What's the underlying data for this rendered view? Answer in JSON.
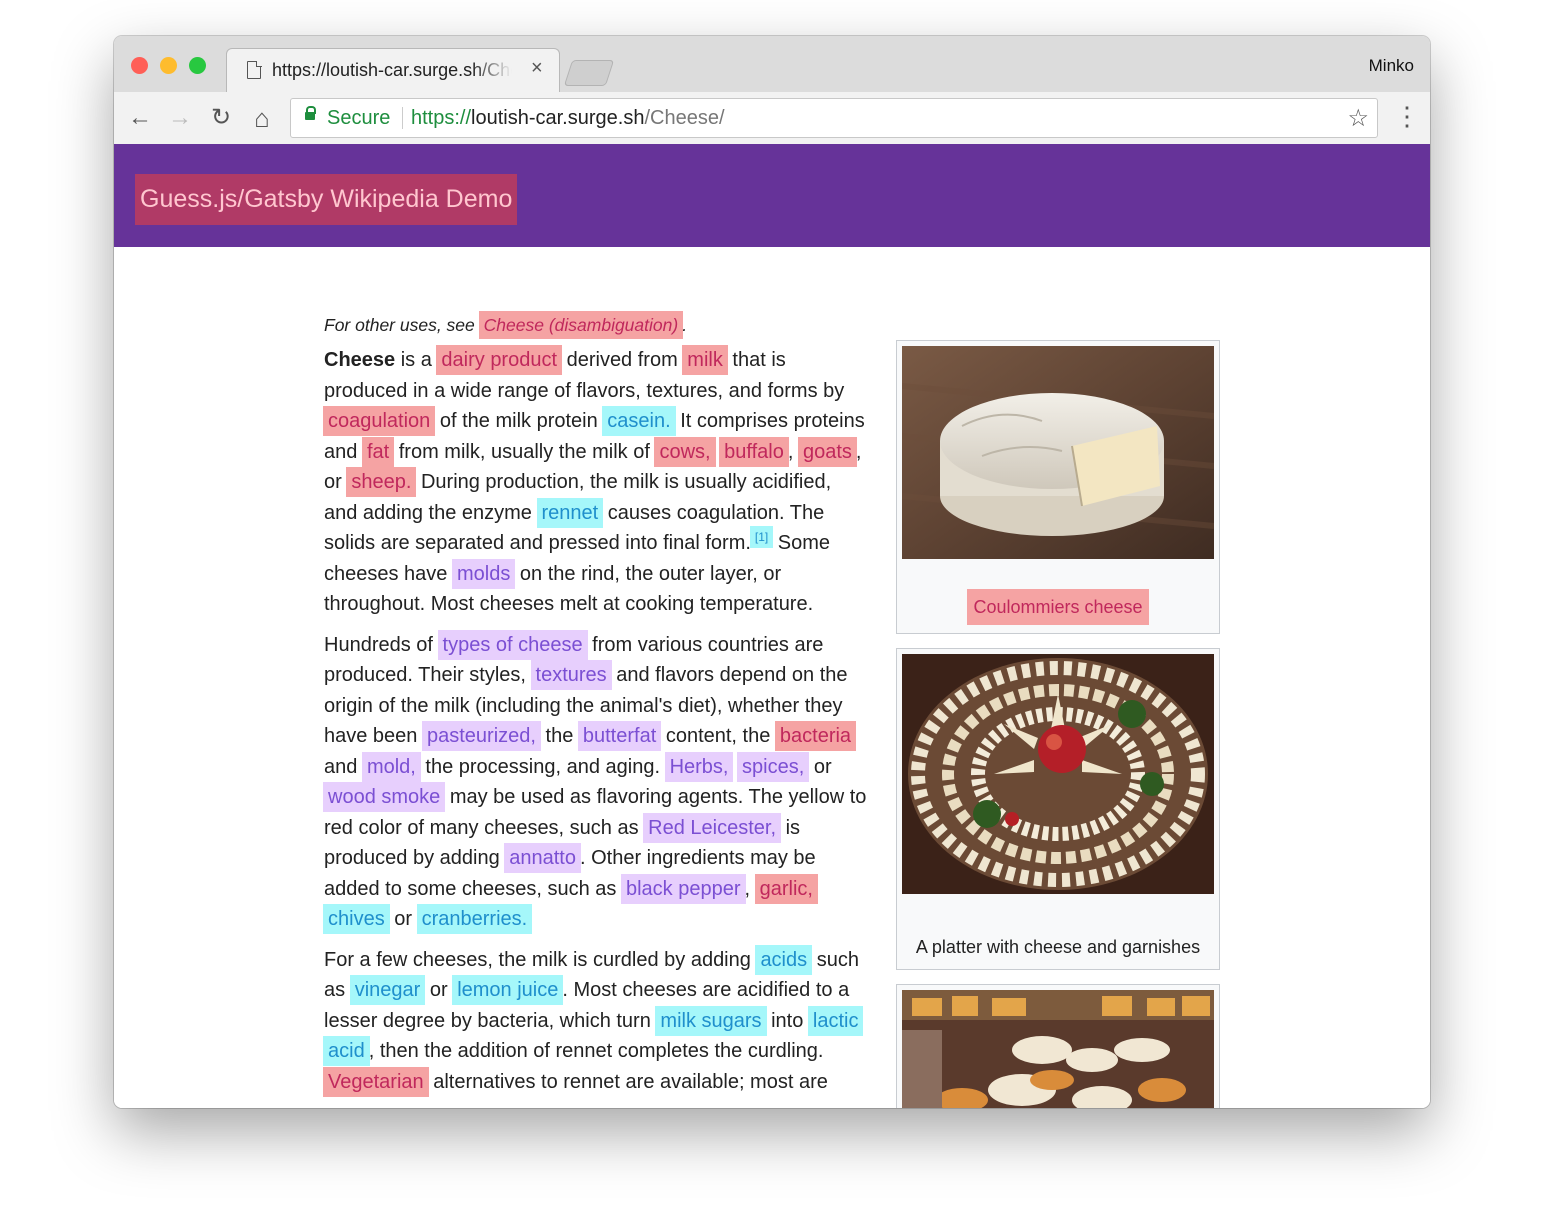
{
  "browser": {
    "tab_title": "https://loutish-car.surge.sh/Cheese/",
    "tab_close": "×",
    "profile_name": "Minko",
    "nav": {
      "back": "←",
      "forward": "→",
      "reload": "↻",
      "home": "⌂"
    },
    "omnibox": {
      "secure_label": "Secure",
      "scheme": "https://",
      "host": "loutish-car.surge.sh",
      "path": "/Cheese/"
    },
    "bookmark_star": "☆",
    "menu_dots": "⋮",
    "traffic_lights": {
      "close": "#ff5f57",
      "minimize": "#febc2e",
      "zoom": "#28c840"
    }
  },
  "site": {
    "title": "Guess.js/Gatsby Wikipedia Demo",
    "header_color": "#663399"
  },
  "legend_colors": {
    "high": "#f5a3a3",
    "medium": "#a5f7fa",
    "low": "#e7cffd"
  },
  "article": {
    "hatnote_prefix": "For other uses, see ",
    "hatnote_link": "Cheese (disambiguation)",
    "hatnote_suffix": ".",
    "p1": {
      "t0": "Cheese",
      "t1": " is a ",
      "dairy_product": "dairy product",
      "t2": " derived from ",
      "milk": "milk",
      "t3": " that is produced in a wide range of flavors, textures, and forms by ",
      "coagulation": "coagulation",
      "t4": " of the milk protein ",
      "casein": "casein.",
      "t5": " It comprises proteins and ",
      "fat": "fat",
      "t6": " from milk, usually the milk of ",
      "cows": "cows,",
      "t7": " ",
      "buffalo": "buffalo",
      "t8": ", ",
      "goats": "goats",
      "t9": ", or ",
      "sheep": "sheep.",
      "t10": " During production, the milk is usually acidified, and adding the enzyme ",
      "rennet": "rennet",
      "t11": " causes coagulation. The solids are separated and pressed into final form.",
      "ref1": "[1]",
      "t12": " Some cheeses have ",
      "molds": "molds",
      "t13": " on the rind, the outer layer, or throughout. Most cheeses melt at cooking temperature."
    },
    "p2": {
      "t0": "Hundreds of ",
      "types_of_cheese": "types of cheese",
      "t1": " from various countries are produced. Their styles, ",
      "textures": "textures",
      "t2": " and flavors depend on the origin of the milk (including the animal's diet), whether they have been ",
      "pasteurized": "pasteurized,",
      "t3": " the ",
      "butterfat": "butterfat",
      "t4": " content, the ",
      "bacteria": "bacteria",
      "t5": " and ",
      "mold": "mold,",
      "t6": " the processing, and aging. ",
      "herbs": "Herbs,",
      "t7": " ",
      "spices": "spices,",
      "t8": " or ",
      "wood_smoke": "wood smoke",
      "t9": " may be used as flavoring agents. The yellow to red color of many cheeses, such as ",
      "red_leicester": "Red Leicester,",
      "t10": " is produced by adding ",
      "annatto": "annatto",
      "t11": ". Other ingredients may be added to some cheeses, such as ",
      "black_pepper": "black pepper",
      "t12": ", ",
      "garlic": "garlic,",
      "t13": " ",
      "chives": "chives",
      "t14": " or ",
      "cranberries": "cranberries."
    },
    "p3": {
      "t0": "For a few cheeses, the milk is curdled by adding ",
      "acids": "acids",
      "t1": " such as ",
      "vinegar": "vinegar",
      "t2": " or ",
      "lemon_juice": "lemon juice",
      "t3": ". Most cheeses are acidified to a lesser degree by bacteria, which turn ",
      "milk_sugars": "milk sugars",
      "t4": " into ",
      "lactic_acid": "lactic acid",
      "t5": ", then the addition of rennet completes the curdling. ",
      "vegetarian": "Vegetarian",
      "t6": " alternatives to rennet are available; most are"
    }
  },
  "infobox": {
    "fig1_caption": "Coulommiers cheese",
    "fig2_caption": "A platter with cheese and garnishes"
  }
}
